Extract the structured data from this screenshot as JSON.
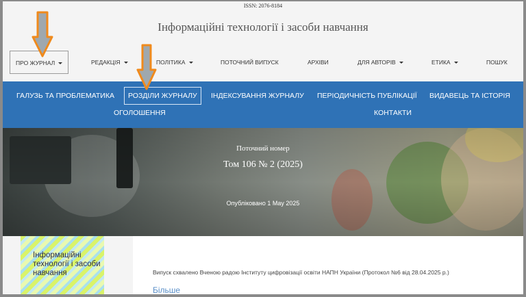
{
  "issn": "ISSN: 2076-8184",
  "site_title": "Інформаційні технології і засоби навчання",
  "top_nav": [
    {
      "label": "ПРО ЖУРНАЛ",
      "dropdown": true,
      "active": true
    },
    {
      "label": "РЕДАКЦІЯ",
      "dropdown": true
    },
    {
      "label": "ПОЛІТИКА",
      "dropdown": true
    },
    {
      "label": "ПОТОЧНИЙ ВИПУСК",
      "dropdown": false
    },
    {
      "label": "АРХІВИ",
      "dropdown": false
    },
    {
      "label": "ДЛЯ АВТОРІВ",
      "dropdown": true
    },
    {
      "label": "ЕТИКА",
      "dropdown": true
    },
    {
      "label": "ПОШУК",
      "dropdown": false
    }
  ],
  "sub_nav": [
    {
      "label": "ГАЛУЗЬ ТА ПРОБЛЕМАТИКА"
    },
    {
      "label": "РОЗДІЛИ ЖУРНАЛУ",
      "active": true
    },
    {
      "label": "ІНДЕКСУВАННЯ ЖУРНАЛУ"
    },
    {
      "label": "ПЕРІОДИЧНІСТЬ ПУБЛІКАЦІЇ"
    },
    {
      "label": "ВИДАВЕЦЬ ТА ІСТОРІЯ"
    },
    {
      "label": "ОГОЛОШЕННЯ"
    },
    {
      "label": "КОНТАКТИ"
    }
  ],
  "hero": {
    "label": "Поточний номер",
    "issue": "Том 106 № 2 (2025)",
    "published": "Опубліковано 1 May 2025"
  },
  "cover_title": "Інформаційні технології і засоби навчання",
  "content": {
    "approved": "Випуск схвалено Вченою радою Інституту цифровізації освіти НАПН України (Протокол №6 від 28.04.2025 р.)",
    "more_link": "Більше"
  },
  "colors": {
    "nav_blue": "#2f72b6",
    "arrow_orange": "#f08a1c",
    "arrow_grey": "#9fa8ae"
  }
}
